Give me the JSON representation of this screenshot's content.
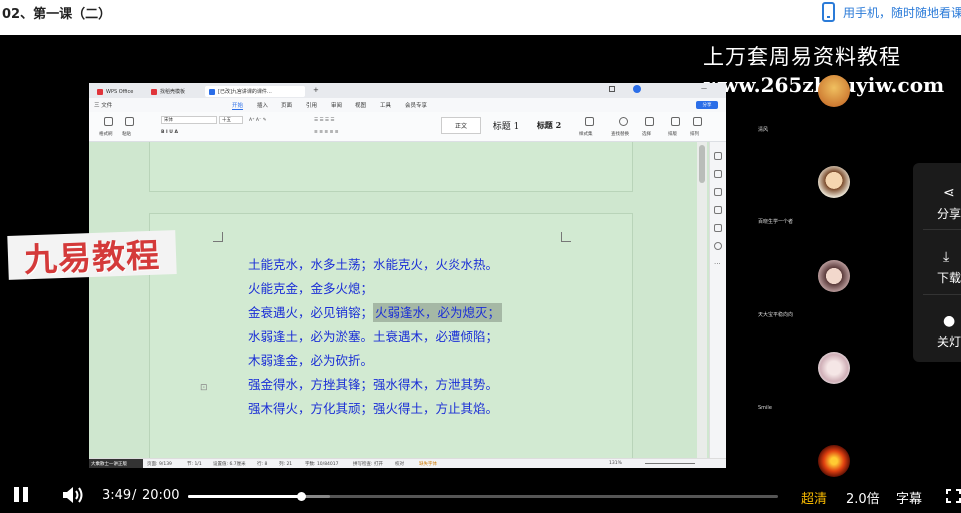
{
  "page": {
    "title": "02、第一课（二）",
    "mobile_promo": "用手机，随时随地看课"
  },
  "video": {
    "watermark_title": "上万套周易资料教程",
    "watermark_url": "www.265zhouyiw.com",
    "brand_overlay": "九易教程",
    "wps": {
      "tabs": [
        "WPS Office",
        "找稻壳模板",
        "[已改]九宫讲课的课件…"
      ],
      "menu": [
        "三 文件",
        "开始",
        "插入",
        "页面",
        "引用",
        "审阅",
        "视图",
        "工具",
        "会员专享"
      ],
      "active_menu": "开始",
      "share": "分享",
      "toolbar_labels": [
        "格式刷",
        "粘贴",
        "宋体",
        "十五",
        "正文",
        "标题 1",
        "标题 2",
        "样式集",
        "查找替换",
        "选择",
        "排版",
        "排列"
      ],
      "document_lines": [
        {
          "text": "土能克水，水多土荡；水能克火，火炎水热。",
          "highlight": ""
        },
        {
          "text": "火能克金，金多火熄；",
          "highlight": ""
        },
        {
          "text": "金衰遇火，必见销镕；",
          "highlight": "火弱逢水，必为熄灭；"
        },
        {
          "text": "水弱逢土，必为淤塞。土衰遇木，必遭倾陷；",
          "highlight": ""
        },
        {
          "text": "木弱逢金，必为砍折。",
          "highlight": ""
        },
        {
          "text": "强金得水，方挫其锋；强水得木，方泄其势。",
          "highlight": ""
        },
        {
          "text": "强木得火，方化其顽；强火得土，方止其焰。",
          "highlight": ""
        }
      ],
      "status": [
        "页面: 9/139",
        "节: 1/1",
        "设置值: 6.7厘米",
        "行: 8",
        "列: 21",
        "字数: 10/84017",
        "拼写检查: 打开",
        "校对",
        "缺失字体",
        "131%"
      ],
      "status_user": "大乘散士一讲正版"
    },
    "participants": [
      {
        "name": "清风",
        "avatar": "avatar-orange"
      },
      {
        "name": "百晓生学一个者",
        "avatar": "avatar-boy"
      },
      {
        "name": "天大宝平稳向向",
        "avatar": "avatar-girl"
      },
      {
        "name": "Smile",
        "avatar": "avatar-light"
      },
      {
        "name": "",
        "avatar": "avatar-fire"
      }
    ],
    "side_actions": [
      {
        "label": "分享",
        "icon": "share-icon"
      },
      {
        "label": "下载",
        "icon": "download-icon"
      },
      {
        "label": "关灯",
        "icon": "light-icon"
      }
    ]
  },
  "controls": {
    "current_time": "3:49",
    "separator": "/",
    "duration": "20:00",
    "progress_fraction": 0.191,
    "buffer_fraction": 0.24,
    "quality": "超清",
    "speed": "2.0倍",
    "subtitle": "字幕",
    "quality_color": "#f5b800"
  }
}
